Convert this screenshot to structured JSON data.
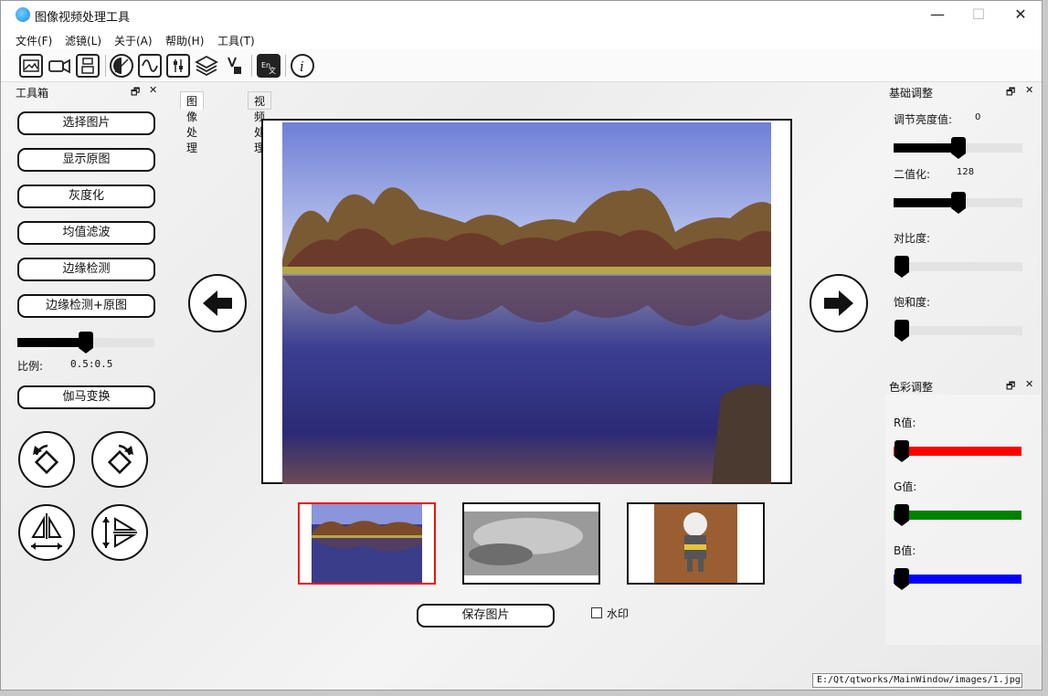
{
  "window": {
    "title": "图像视频处理工具",
    "minimize": "—",
    "maximize": "☐",
    "close": "✕"
  },
  "menu": [
    "文件(F)",
    "滤镜(L)",
    "关于(A)",
    "帮助(H)",
    "工具(T)"
  ],
  "toolbar_icons": [
    "image-icon",
    "video-camera-icon",
    "save-icon",
    "contrast-icon",
    "wave-icon",
    "sliders-icon",
    "layers-icon",
    "crop-icon",
    "translate-icon",
    "info-icon"
  ],
  "toolbox": {
    "title": "工具箱",
    "float": "🗗",
    "close": "✕",
    "buttons": [
      "选择图片",
      "显示原图",
      "灰度化",
      "均值滤波",
      "边缘检测",
      "边缘检测+原图"
    ],
    "ratio_label": "比例:",
    "ratio_value": "0.5:0.5",
    "ratio_slider": 0.5,
    "gamma_button": "伽马变换"
  },
  "tabs": [
    "图像处理",
    "视频处理"
  ],
  "save_button": "保存图片",
  "watermark_label": "水印",
  "basic_panel": {
    "title": "基础调整",
    "brightness_label": "调节亮度值:",
    "brightness_value": "0",
    "brightness_level": 0.5,
    "binary_label": "二值化:",
    "binary_value": "128",
    "binary_level": 0.5,
    "contrast_label": "对比度:",
    "contrast_level": 0.0,
    "saturation_label": "饱和度:",
    "saturation_level": 0.0
  },
  "color_panel": {
    "title": "色彩调整",
    "r_label": "R值:",
    "g_label": "G值:",
    "b_label": "B值:",
    "r_color": "#ff0000",
    "g_color": "#008000",
    "b_color": "#0000ff"
  },
  "status_path": "E:/Qt/qtworks/MainWindow/images/1.jpg"
}
